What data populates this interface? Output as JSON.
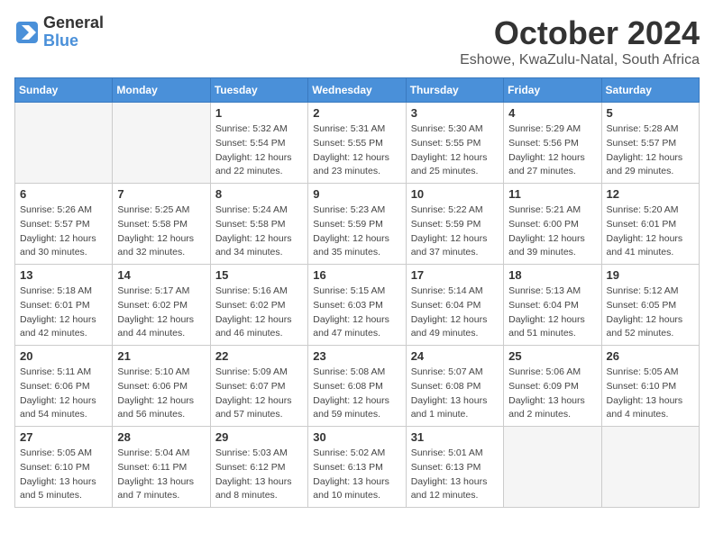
{
  "header": {
    "logo_line1": "General",
    "logo_line2": "Blue",
    "month_title": "October 2024",
    "location": "Eshowe, KwaZulu-Natal, South Africa"
  },
  "days_of_week": [
    "Sunday",
    "Monday",
    "Tuesday",
    "Wednesday",
    "Thursday",
    "Friday",
    "Saturday"
  ],
  "weeks": [
    [
      {
        "day": "",
        "info": ""
      },
      {
        "day": "",
        "info": ""
      },
      {
        "day": "1",
        "info": "Sunrise: 5:32 AM\nSunset: 5:54 PM\nDaylight: 12 hours and 22 minutes."
      },
      {
        "day": "2",
        "info": "Sunrise: 5:31 AM\nSunset: 5:55 PM\nDaylight: 12 hours and 23 minutes."
      },
      {
        "day": "3",
        "info": "Sunrise: 5:30 AM\nSunset: 5:55 PM\nDaylight: 12 hours and 25 minutes."
      },
      {
        "day": "4",
        "info": "Sunrise: 5:29 AM\nSunset: 5:56 PM\nDaylight: 12 hours and 27 minutes."
      },
      {
        "day": "5",
        "info": "Sunrise: 5:28 AM\nSunset: 5:57 PM\nDaylight: 12 hours and 29 minutes."
      }
    ],
    [
      {
        "day": "6",
        "info": "Sunrise: 5:26 AM\nSunset: 5:57 PM\nDaylight: 12 hours and 30 minutes."
      },
      {
        "day": "7",
        "info": "Sunrise: 5:25 AM\nSunset: 5:58 PM\nDaylight: 12 hours and 32 minutes."
      },
      {
        "day": "8",
        "info": "Sunrise: 5:24 AM\nSunset: 5:58 PM\nDaylight: 12 hours and 34 minutes."
      },
      {
        "day": "9",
        "info": "Sunrise: 5:23 AM\nSunset: 5:59 PM\nDaylight: 12 hours and 35 minutes."
      },
      {
        "day": "10",
        "info": "Sunrise: 5:22 AM\nSunset: 5:59 PM\nDaylight: 12 hours and 37 minutes."
      },
      {
        "day": "11",
        "info": "Sunrise: 5:21 AM\nSunset: 6:00 PM\nDaylight: 12 hours and 39 minutes."
      },
      {
        "day": "12",
        "info": "Sunrise: 5:20 AM\nSunset: 6:01 PM\nDaylight: 12 hours and 41 minutes."
      }
    ],
    [
      {
        "day": "13",
        "info": "Sunrise: 5:18 AM\nSunset: 6:01 PM\nDaylight: 12 hours and 42 minutes."
      },
      {
        "day": "14",
        "info": "Sunrise: 5:17 AM\nSunset: 6:02 PM\nDaylight: 12 hours and 44 minutes."
      },
      {
        "day": "15",
        "info": "Sunrise: 5:16 AM\nSunset: 6:02 PM\nDaylight: 12 hours and 46 minutes."
      },
      {
        "day": "16",
        "info": "Sunrise: 5:15 AM\nSunset: 6:03 PM\nDaylight: 12 hours and 47 minutes."
      },
      {
        "day": "17",
        "info": "Sunrise: 5:14 AM\nSunset: 6:04 PM\nDaylight: 12 hours and 49 minutes."
      },
      {
        "day": "18",
        "info": "Sunrise: 5:13 AM\nSunset: 6:04 PM\nDaylight: 12 hours and 51 minutes."
      },
      {
        "day": "19",
        "info": "Sunrise: 5:12 AM\nSunset: 6:05 PM\nDaylight: 12 hours and 52 minutes."
      }
    ],
    [
      {
        "day": "20",
        "info": "Sunrise: 5:11 AM\nSunset: 6:06 PM\nDaylight: 12 hours and 54 minutes."
      },
      {
        "day": "21",
        "info": "Sunrise: 5:10 AM\nSunset: 6:06 PM\nDaylight: 12 hours and 56 minutes."
      },
      {
        "day": "22",
        "info": "Sunrise: 5:09 AM\nSunset: 6:07 PM\nDaylight: 12 hours and 57 minutes."
      },
      {
        "day": "23",
        "info": "Sunrise: 5:08 AM\nSunset: 6:08 PM\nDaylight: 12 hours and 59 minutes."
      },
      {
        "day": "24",
        "info": "Sunrise: 5:07 AM\nSunset: 6:08 PM\nDaylight: 13 hours and 1 minute."
      },
      {
        "day": "25",
        "info": "Sunrise: 5:06 AM\nSunset: 6:09 PM\nDaylight: 13 hours and 2 minutes."
      },
      {
        "day": "26",
        "info": "Sunrise: 5:05 AM\nSunset: 6:10 PM\nDaylight: 13 hours and 4 minutes."
      }
    ],
    [
      {
        "day": "27",
        "info": "Sunrise: 5:05 AM\nSunset: 6:10 PM\nDaylight: 13 hours and 5 minutes."
      },
      {
        "day": "28",
        "info": "Sunrise: 5:04 AM\nSunset: 6:11 PM\nDaylight: 13 hours and 7 minutes."
      },
      {
        "day": "29",
        "info": "Sunrise: 5:03 AM\nSunset: 6:12 PM\nDaylight: 13 hours and 8 minutes."
      },
      {
        "day": "30",
        "info": "Sunrise: 5:02 AM\nSunset: 6:13 PM\nDaylight: 13 hours and 10 minutes."
      },
      {
        "day": "31",
        "info": "Sunrise: 5:01 AM\nSunset: 6:13 PM\nDaylight: 13 hours and 12 minutes."
      },
      {
        "day": "",
        "info": ""
      },
      {
        "day": "",
        "info": ""
      }
    ]
  ]
}
